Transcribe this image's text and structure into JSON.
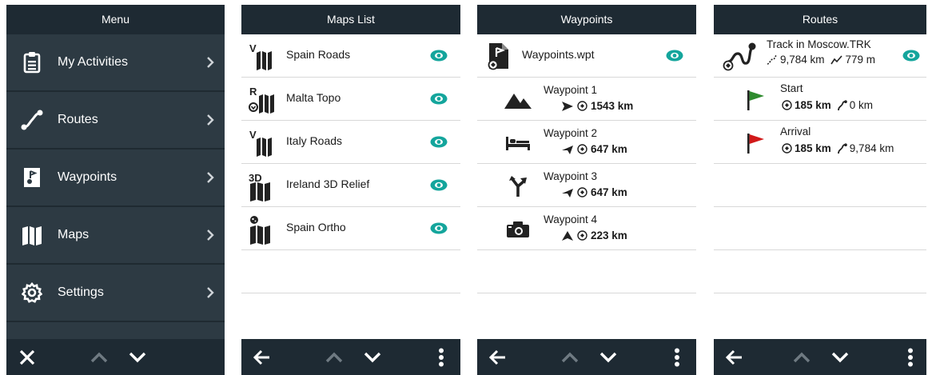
{
  "colors": {
    "bar": "#1e2a33",
    "menu_bg": "#2d3a43",
    "accent_teal": "#14a59c",
    "flag_green": "#2e8b2e",
    "flag_red": "#d11a1a"
  },
  "menu": {
    "title": "Menu",
    "items": [
      {
        "label": "My Activities",
        "icon": "clipboard-icon"
      },
      {
        "label": "Routes",
        "icon": "route-icon"
      },
      {
        "label": "Waypoints",
        "icon": "waypoint-file-icon"
      },
      {
        "label": "Maps",
        "icon": "map-icon"
      },
      {
        "label": "Settings",
        "icon": "gear-icon"
      }
    ],
    "bottom": [
      "close-icon",
      "chevron-up-icon",
      "chevron-down-icon"
    ]
  },
  "maps": {
    "title": "Maps List",
    "items": [
      {
        "label": "Spain Roads",
        "badge": "V"
      },
      {
        "label": "Malta Topo",
        "badge": "R"
      },
      {
        "label": "Italy Roads",
        "badge": "V"
      },
      {
        "label": "Ireland 3D Relief",
        "badge": "3D"
      },
      {
        "label": "Spain Ortho",
        "badge": ""
      }
    ],
    "bottom": [
      "back-arrow-icon",
      "chevron-up-icon",
      "chevron-down-icon",
      "more-vertical-icon"
    ]
  },
  "waypoints": {
    "title": "Waypoints",
    "file": "Waypoints.wpt",
    "items": [
      {
        "name": "Waypoint 1",
        "distance": "1543 km",
        "icon": "mountain-icon"
      },
      {
        "name": "Waypoint 2",
        "distance": "647 km",
        "icon": "bed-icon"
      },
      {
        "name": "Waypoint 3",
        "distance": "647 km",
        "icon": "junction-icon"
      },
      {
        "name": "Waypoint 4",
        "distance": "223 km",
        "icon": "camera-icon"
      }
    ],
    "bottom": [
      "back-arrow-icon",
      "chevron-up-icon",
      "chevron-down-icon",
      "more-vertical-icon"
    ]
  },
  "routes": {
    "title": "Routes",
    "track": {
      "name": "Track in Moscow.TRK",
      "length": "9,784 km",
      "elevation": "779 m"
    },
    "points": [
      {
        "name": "Start",
        "distance": "185 km",
        "along": "0 km",
        "flag": "green"
      },
      {
        "name": "Arrival",
        "distance": "185 km",
        "along": "9,784 km",
        "flag": "red"
      }
    ],
    "bottom": [
      "back-arrow-icon",
      "chevron-up-icon",
      "chevron-down-icon",
      "more-vertical-icon"
    ]
  }
}
